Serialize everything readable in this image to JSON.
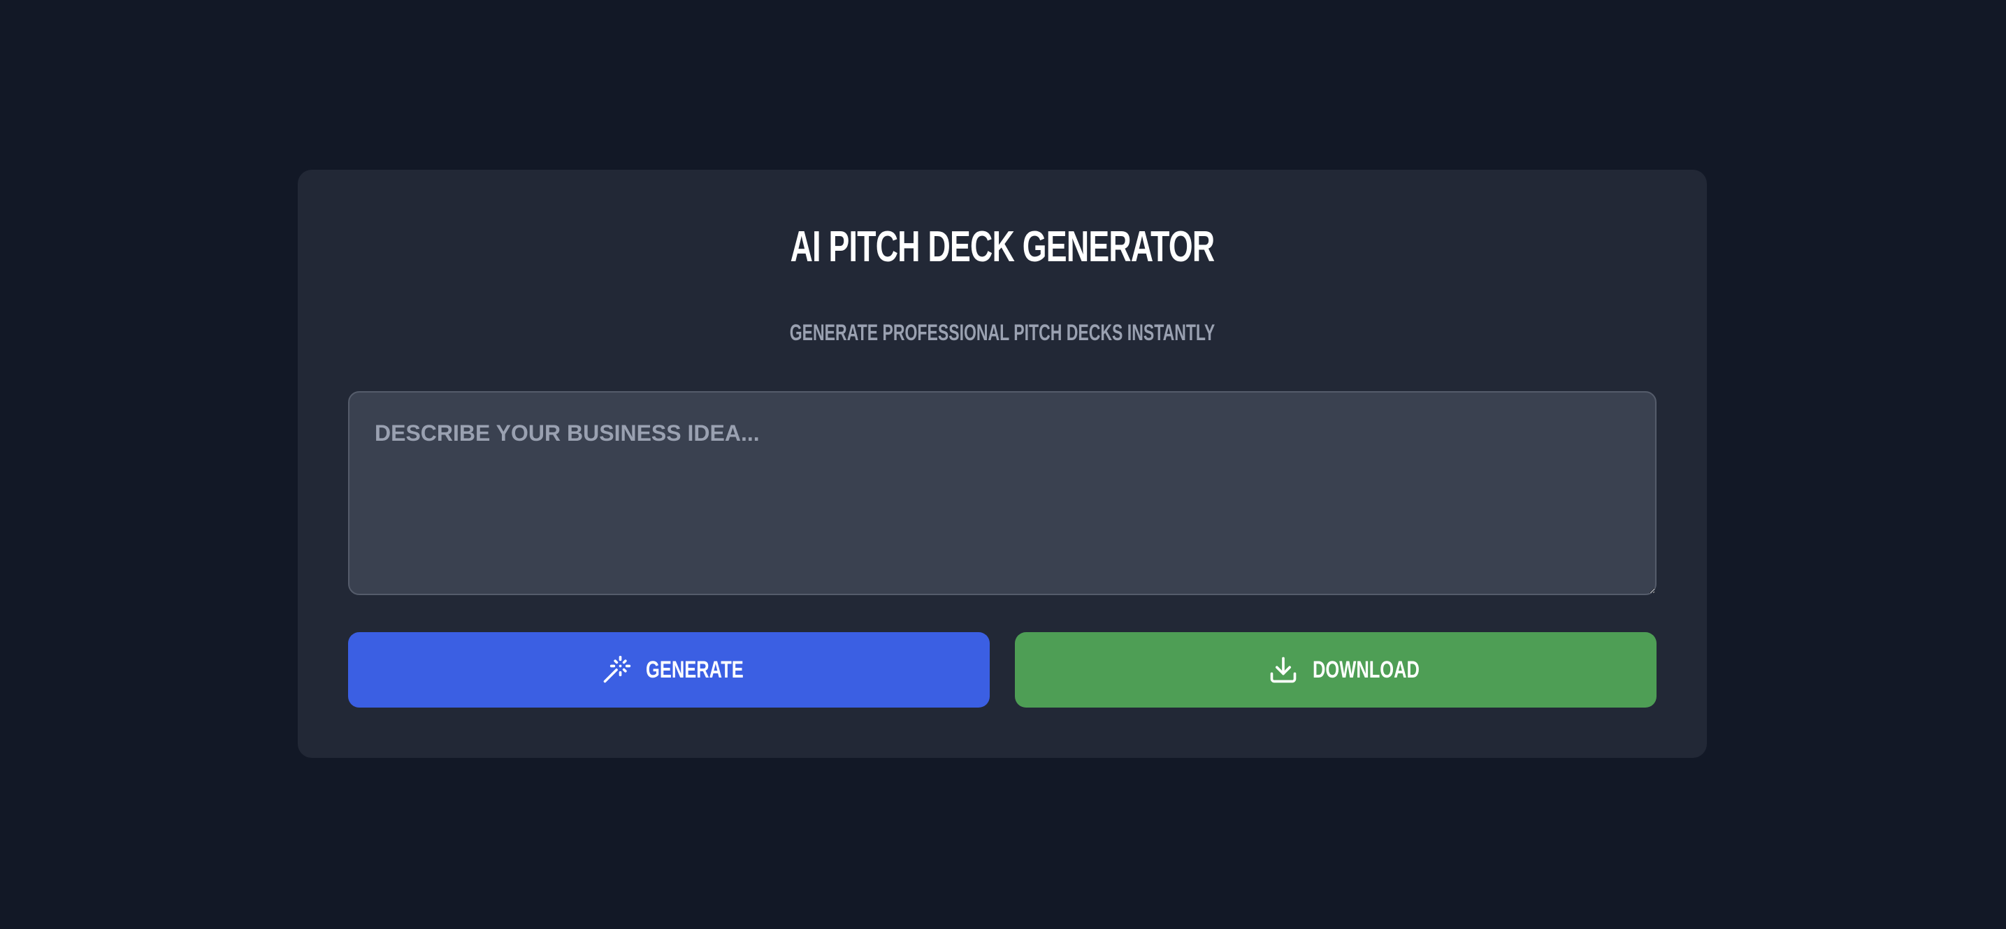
{
  "app": {
    "title": "AI PITCH DECK GENERATOR",
    "subtitle": "GENERATE PROFESSIONAL PITCH DECKS INSTANTLY"
  },
  "idea_input": {
    "value": "",
    "placeholder": "DESCRIBE YOUR BUSINESS IDEA..."
  },
  "actions": {
    "generate": {
      "label": "GENERATE",
      "icon": "magic-wand-icon",
      "color": "#3b5fe3"
    },
    "download": {
      "label": "DOWNLOAD",
      "icon": "download-icon",
      "color": "#4e9e55"
    }
  },
  "theme": {
    "background": "#121826",
    "card": "#222836",
    "input": "#3a4150",
    "text": "#ffffff",
    "muted": "#9aa1b1"
  }
}
